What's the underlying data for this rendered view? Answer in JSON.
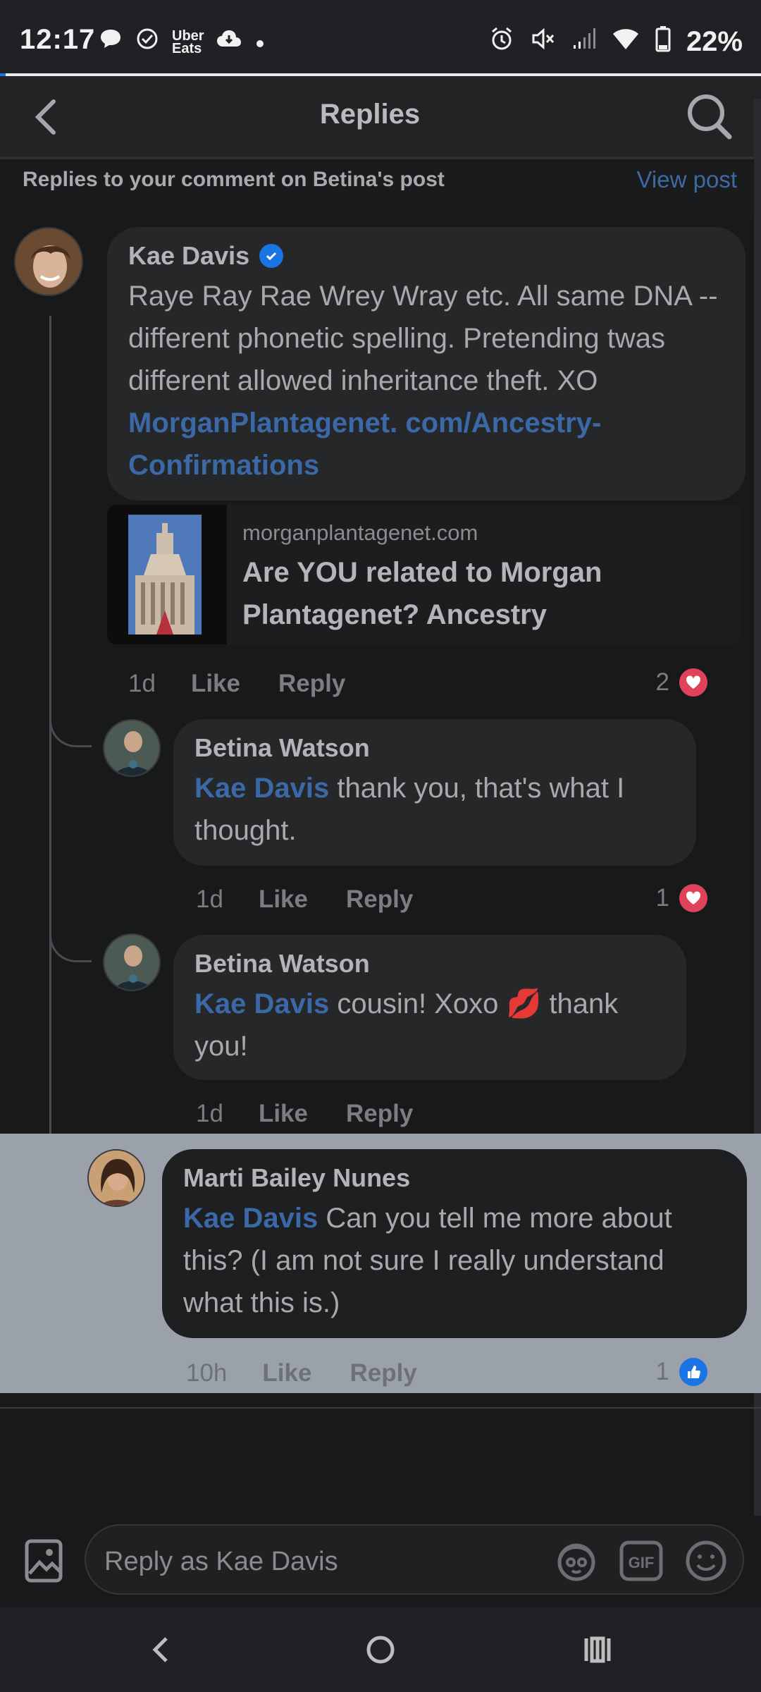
{
  "status_bar": {
    "time": "12:17",
    "uber_label": "Uber\nEats",
    "battery": "22%"
  },
  "header": {
    "title": "Replies"
  },
  "subheader": {
    "text": "Replies to your comment on Betina's post",
    "view_post": "View post"
  },
  "comments": [
    {
      "author": "Kae Davis",
      "verified": true,
      "text": "Raye Ray Rae Wrey Wray etc. All same DNA -- different phonetic spelling. Pretending twas different allowed inheritance theft. XO ",
      "link_text": "MorganPlantagenet.com/Ancestry-Confirmations",
      "link_line1": "MorganPlantagenet.",
      "link_line2": "com/Ancestry-Confirmations",
      "preview": {
        "domain": "morganplantagenet.com",
        "title": "Are YOU related to Morgan Plantagenet? Ancestry"
      },
      "time": "1d",
      "like": "Like",
      "reply": "Reply",
      "reaction_count": "2",
      "reaction": "heart"
    },
    {
      "author": "Betina Watson",
      "mention": "Kae Davis",
      "text": " thank you, that's what I thought.",
      "time": "1d",
      "like": "Like",
      "reply": "Reply",
      "reaction_count": "1",
      "reaction": "heart"
    },
    {
      "author": "Betina Watson",
      "mention": "Kae Davis",
      "text_a": " cousin! Xoxo ",
      "emoji": "💋",
      "text_b": " thank you!",
      "time": "1d",
      "like": "Like",
      "reply": "Reply"
    },
    {
      "author": "Marti Bailey Nunes",
      "mention": "Kae Davis",
      "text": " Can you tell me more about this? (I am not sure I really understand what this is.)",
      "time": "10h",
      "like": "Like",
      "reply": "Reply",
      "reaction_count": "1",
      "reaction": "like"
    }
  ],
  "composer": {
    "placeholder": "Reply as Kae Davis",
    "gif_label": "GIF"
  },
  "colors": {
    "accent": "#1b74e4",
    "link": "#3b68a6",
    "heart": "#e0425c",
    "highlight_bg": "#9aa1ab"
  }
}
